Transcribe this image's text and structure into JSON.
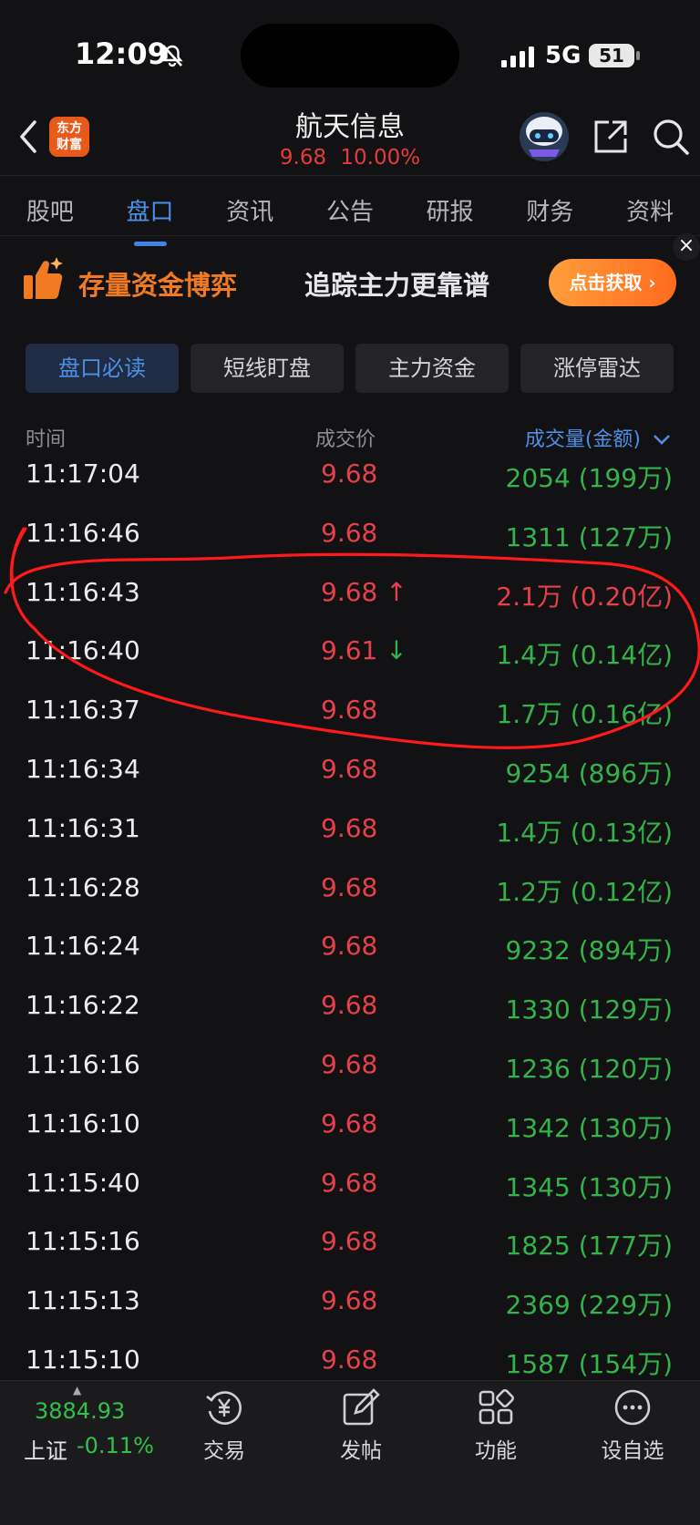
{
  "status": {
    "time": "12:09",
    "network": "5G",
    "battery": "51"
  },
  "header": {
    "logo_line1": "东方",
    "logo_line2": "财富",
    "title": "航天信息",
    "price": "9.68",
    "change": "10.00%"
  },
  "tabs": [
    "股吧",
    "盘口",
    "资讯",
    "公告",
    "研报",
    "财务",
    "资料"
  ],
  "banner": {
    "main": "存量资金博弈",
    "sub": "追踪主力更靠谱",
    "button": "点击获取 ›",
    "close": "×"
  },
  "segments": [
    "盘口必读",
    "短线盯盘",
    "主力资金",
    "涨停雷达"
  ],
  "list_header": {
    "time": "时间",
    "price": "成交价",
    "volume": "成交量(金额)"
  },
  "trades": [
    {
      "time": "11:17:04",
      "price": "9.68",
      "arrow": "",
      "volume": "2054 (199万)",
      "vcolor": "green"
    },
    {
      "time": "11:16:46",
      "price": "9.68",
      "arrow": "",
      "volume": "1311 (127万)",
      "vcolor": "green"
    },
    {
      "time": "11:16:43",
      "price": "9.68",
      "arrow": "↑",
      "volume": "2.1万 (0.20亿)",
      "vcolor": "red"
    },
    {
      "time": "11:16:40",
      "price": "9.61",
      "arrow": "↓",
      "volume": "1.4万 (0.14亿)",
      "vcolor": "green"
    },
    {
      "time": "11:16:37",
      "price": "9.68",
      "arrow": "",
      "volume": "1.7万 (0.16亿)",
      "vcolor": "green"
    },
    {
      "time": "11:16:34",
      "price": "9.68",
      "arrow": "",
      "volume": "9254 (896万)",
      "vcolor": "green"
    },
    {
      "time": "11:16:31",
      "price": "9.68",
      "arrow": "",
      "volume": "1.4万 (0.13亿)",
      "vcolor": "green"
    },
    {
      "time": "11:16:28",
      "price": "9.68",
      "arrow": "",
      "volume": "1.2万 (0.12亿)",
      "vcolor": "green"
    },
    {
      "time": "11:16:24",
      "price": "9.68",
      "arrow": "",
      "volume": "9232 (894万)",
      "vcolor": "green"
    },
    {
      "time": "11:16:22",
      "price": "9.68",
      "arrow": "",
      "volume": "1330 (129万)",
      "vcolor": "green"
    },
    {
      "time": "11:16:16",
      "price": "9.68",
      "arrow": "",
      "volume": "1236 (120万)",
      "vcolor": "green"
    },
    {
      "time": "11:16:10",
      "price": "9.68",
      "arrow": "",
      "volume": "1342 (130万)",
      "vcolor": "green"
    },
    {
      "time": "11:15:40",
      "price": "9.68",
      "arrow": "",
      "volume": "1345 (130万)",
      "vcolor": "green"
    },
    {
      "time": "11:15:16",
      "price": "9.68",
      "arrow": "",
      "volume": "1825 (177万)",
      "vcolor": "green"
    },
    {
      "time": "11:15:13",
      "price": "9.68",
      "arrow": "",
      "volume": "2369 (229万)",
      "vcolor": "green"
    },
    {
      "time": "11:15:10",
      "price": "9.68",
      "arrow": "",
      "volume": "1587 (154万)",
      "vcolor": "green"
    }
  ],
  "index": {
    "value": "3884.93",
    "name": "上证",
    "change": "-0.11%"
  },
  "bottom_nav": [
    "交易",
    "发帖",
    "功能",
    "设自选"
  ],
  "colors": {
    "up": "#e5404b",
    "down": "#33b34a",
    "accent": "#4e8fe6",
    "brand": "#e85a1a",
    "annotation": "#ff1a1a"
  }
}
